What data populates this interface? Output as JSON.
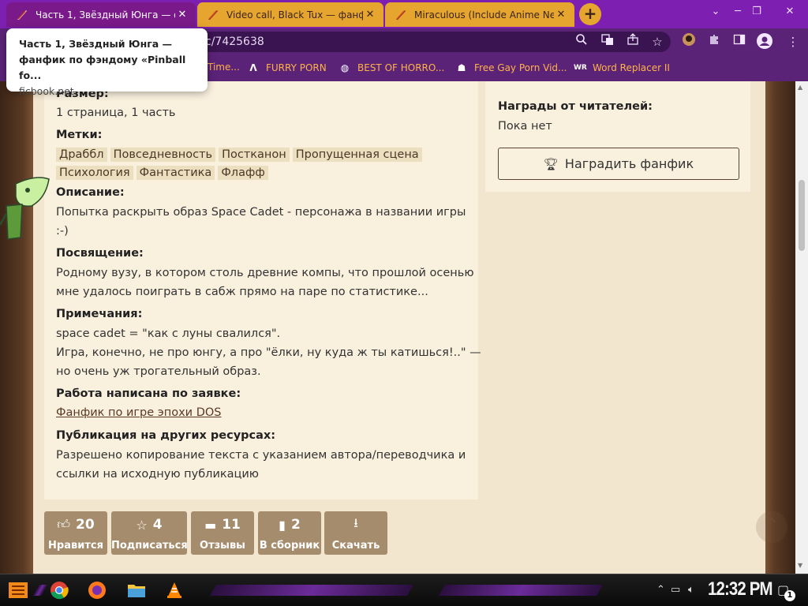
{
  "colors": {
    "tab_strip": "#7d1fb0",
    "toolbar": "#5b2378",
    "bookmark_text": "#ffb347",
    "inactive_tab": "#e6a52e",
    "parchment": "#f3e6cf",
    "card": "#faf0de",
    "action_button": "#a58c6c"
  },
  "browser": {
    "tabs": [
      {
        "title": "Часть 1, Звёздный Юнга — фанфик",
        "icon": "ficbook-quill-icon",
        "close": "✕"
      },
      {
        "title": "Video call, Black Tux — фанфик",
        "icon": "ficbook-quill-icon",
        "close": "✕"
      },
      {
        "title": "Miraculous (Include Anime Ner",
        "icon": "ficbook-quill-icon",
        "close": "✕"
      }
    ],
    "new_tab": "+",
    "url_fragment": "c/7425638",
    "bookmarks": [
      {
        "label": "Time...",
        "icon": "bookmark-icon"
      },
      {
        "label": "FURRY PORN",
        "icon": "lambda-icon"
      },
      {
        "label": "BEST OF HORRO...",
        "icon": "globe-icon"
      },
      {
        "label": "Free Gay Porn Vid...",
        "icon": "bookmark-icon"
      },
      {
        "label": "Word Replacer II",
        "icon": "word-replacer-icon"
      }
    ],
    "tooltip": {
      "title": "Часть 1, Звёздный Юнга — фанфик по фэндому «Pinball fo...",
      "domain": "ficbook.net"
    }
  },
  "fic": {
    "size_label": "Размер:",
    "size_value": "1 страница, 1 часть",
    "tags_label": "Метки:",
    "tags": [
      "Драббл",
      "Повседневность",
      "Постканон",
      "Пропущенная сцена",
      "Психология",
      "Фантастика",
      "Флафф"
    ],
    "description_label": "Описание:",
    "description_lines": [
      "Попытка раскрыть образ Space Cadet - персонажа в названии игры",
      ":-)"
    ],
    "dedication_label": "Посвящение:",
    "dedication_lines": [
      "Родному вузу, в котором столь древние компы, что прошлой осенью",
      "мне удалось поиграть в сабж прямо на паре по статистике..."
    ],
    "notes_label": "Примечания:",
    "notes_lines": [
      "space cadet = \"как с луны свалился\".",
      "Игра, конечно, не про юнгу, а про \"ёлки, ну куда ж ты катишься!..\" —",
      "но очень уж трогательный образ."
    ],
    "request_label": "Работа написана по заявке:",
    "request_link": "Фанфик по игре эпохи DOS",
    "publication_label": "Публикация на других ресурсах:",
    "publication_lines": [
      "Разрешено копирование текста с указанием автора/переводчика и",
      "ссылки на исходную публикацию"
    ]
  },
  "sidebar": {
    "awards_label": "Награды от читателей:",
    "awards_value": "Пока нет",
    "award_button": "Наградить фанфик"
  },
  "actions": [
    {
      "count": "20",
      "label": "Нравится",
      "icon": "thumbs-up-icon"
    },
    {
      "count": "4",
      "label": "Подписаться",
      "icon": "star-icon"
    },
    {
      "count": "11",
      "label": "Отзывы",
      "icon": "comment-icon"
    },
    {
      "count": "2",
      "label": "В сборник",
      "icon": "book-icon"
    },
    {
      "count": "",
      "label": "Скачать",
      "icon": "download-icon"
    }
  ],
  "taskbar": {
    "clock": "12:32 PM",
    "notification_count": "1",
    "apps": [
      "chrome-icon",
      "firefox-icon",
      "file-explorer-icon",
      "vlc-icon"
    ]
  }
}
